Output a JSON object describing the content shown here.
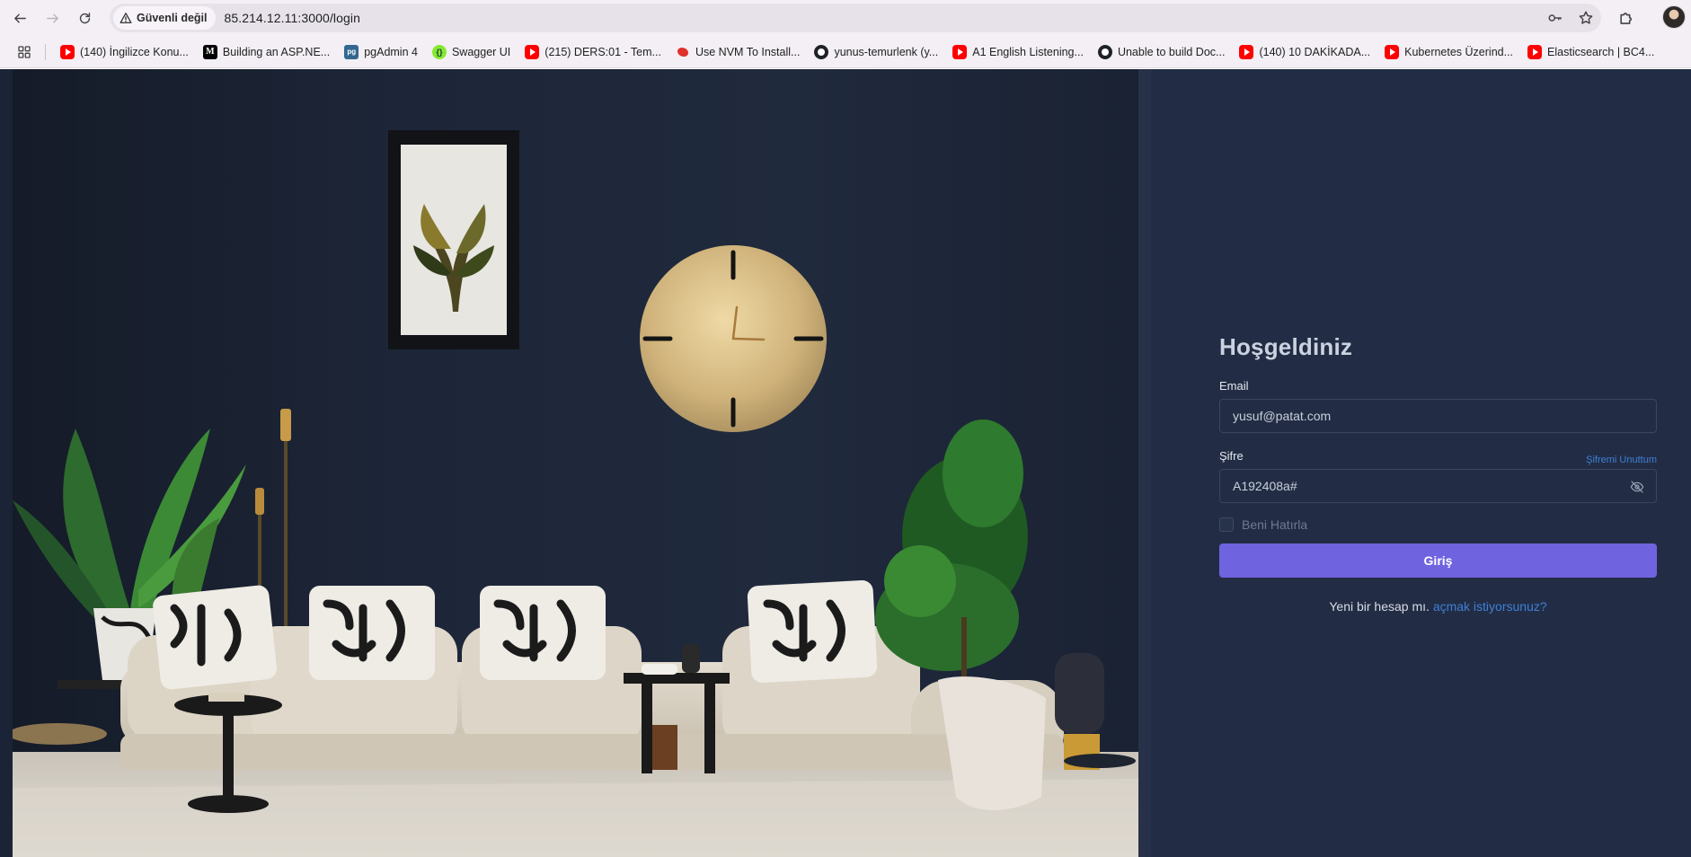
{
  "browser": {
    "security_label": "Güvenli değil",
    "url": "85.214.12.11:3000/login",
    "bookmarks": [
      {
        "label": "(140) İngilizce Konu...",
        "icon": "youtube-icon"
      },
      {
        "label": "Building an ASP.NE...",
        "icon": "medium-icon"
      },
      {
        "label": "pgAdmin 4",
        "icon": "pgadmin-icon"
      },
      {
        "label": "Swagger UI",
        "icon": "swagger-icon"
      },
      {
        "label": "(215) DERS:01 - Tem...",
        "icon": "youtube-icon"
      },
      {
        "label": "Use NVM To Install...",
        "icon": "nvm-icon"
      },
      {
        "label": "yunus-temurlenk (y...",
        "icon": "github-icon"
      },
      {
        "label": "A1 English Listening...",
        "icon": "youtube-icon"
      },
      {
        "label": "Unable to build Doc...",
        "icon": "github-icon"
      },
      {
        "label": "(140) 10 DAKİKADA...",
        "icon": "youtube-icon"
      },
      {
        "label": "Kubernetes Üzerind...",
        "icon": "youtube-icon"
      },
      {
        "label": "Elasticsearch | BC4...",
        "icon": "youtube-icon"
      }
    ]
  },
  "login": {
    "title": "Hoşgeldiniz",
    "email_label": "Email",
    "email_value": "yusuf@patat.com",
    "password_label": "Şifre",
    "forgot_label": "Şifremi Unuttum",
    "password_value": "A192408a#",
    "remember_label": "Beni Hatırla",
    "submit_label": "Giriş",
    "signup_prefix": "Yeni bir hesap mı.",
    "signup_link": "açmak istiyorsunuz?"
  },
  "colors": {
    "panel_bg": "#222d45",
    "accent": "#7063e0",
    "link": "#3f7fd6"
  }
}
